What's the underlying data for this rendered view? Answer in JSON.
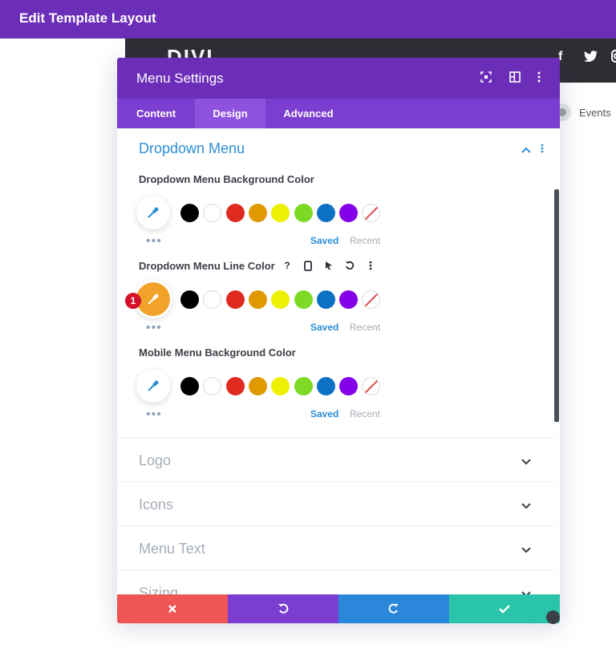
{
  "topbar": {
    "title": "Edit Template Layout"
  },
  "site": {
    "logo": "DIVI",
    "nav_item": "Events",
    "social_icons": [
      "facebook-icon",
      "twitter-icon",
      "instagram-icon"
    ]
  },
  "modal": {
    "title": "Menu Settings",
    "header_icons": [
      "fullscreen-icon",
      "split-view-icon",
      "more-options-icon"
    ],
    "tabs": [
      {
        "label": "Content",
        "active": false
      },
      {
        "label": "Design",
        "active": true
      },
      {
        "label": "Advanced",
        "active": false
      }
    ],
    "open_section": {
      "title": "Dropdown Menu",
      "fields": [
        {
          "label": "Dropdown Menu Background Color",
          "active": false
        },
        {
          "label": "Dropdown Menu Line Color",
          "active": true,
          "badge": "1",
          "hover_icons": [
            "help-icon",
            "mobile-icon",
            "cursor-icon",
            "reset-icon",
            "more-icon"
          ]
        },
        {
          "label": "Mobile Menu Background Color",
          "active": false
        }
      ],
      "palette": [
        "#000000",
        "#ffffff",
        "#e02b20",
        "#e09900",
        "#edf000",
        "#7cda24",
        "#0c71c3",
        "#8300e9",
        "none"
      ],
      "picker_active_color": "#f0a229",
      "saved_label": "Saved",
      "recent_label": "Recent"
    },
    "collapsed_sections": [
      {
        "title": "Logo"
      },
      {
        "title": "Icons"
      },
      {
        "title": "Menu Text"
      },
      {
        "title": "Sizing"
      }
    ],
    "footer": {
      "cancel_color": "#ef5555",
      "undo_color": "#7b3ed1",
      "redo_color": "#2b87da",
      "save_color": "#29c4a9"
    }
  }
}
